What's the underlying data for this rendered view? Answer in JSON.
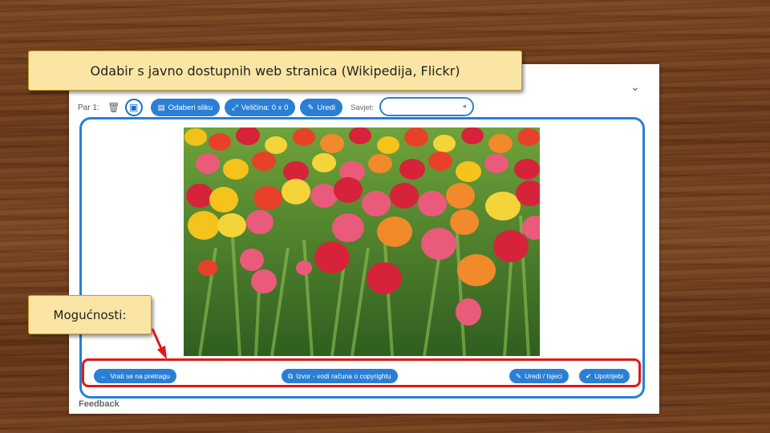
{
  "callouts": {
    "title": "Odabir s javno dostupnih web stranica (Wikipedija, Flickr)",
    "options": "Mogućnosti:"
  },
  "toolbar": {
    "par_label": "Par 1:",
    "delete_icon": "trash-icon",
    "image_icon": "image-icon",
    "choose_image_label": "Odaberi sliku",
    "size_label": "Veličina: 0 x 0",
    "edit_label": "Uredi",
    "tip_label": "Savjet:",
    "tip_value": ""
  },
  "actions": {
    "back_label": "Vrati se na pretragu",
    "source_label": "Izvor - vodi računa o copyrightu",
    "edit_crop_label": "Uredi / Isjeci",
    "use_label": "Upotrijebi"
  },
  "footer": {
    "feedback": "Feedback"
  },
  "colors": {
    "accent": "#2a7fd4",
    "highlight": "#e01818",
    "callout_bg": "#fbe5a4"
  }
}
